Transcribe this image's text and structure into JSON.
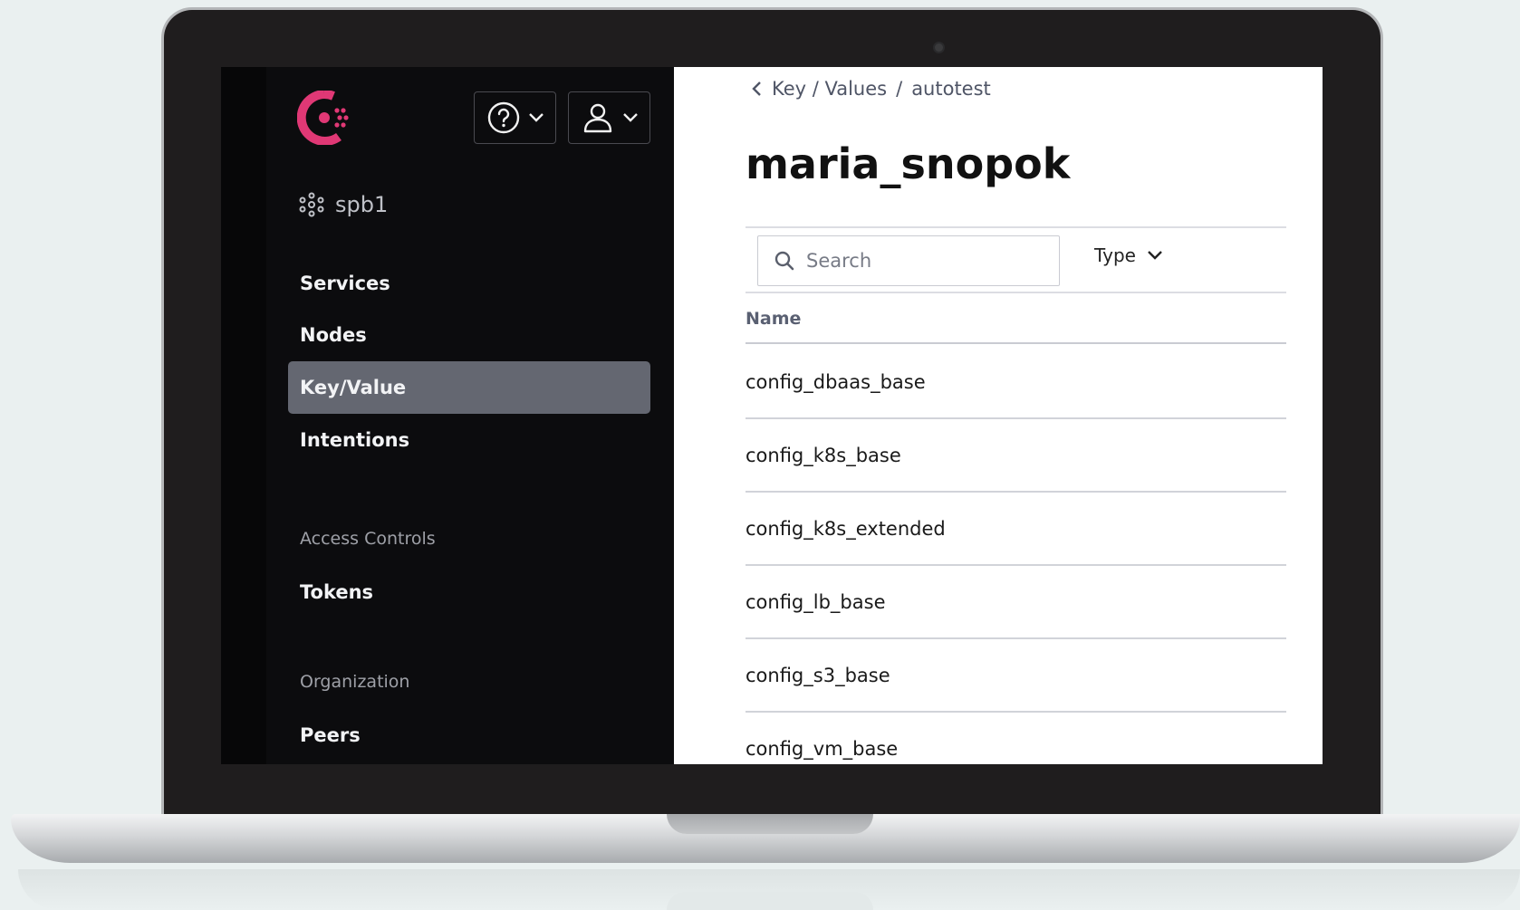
{
  "sidebar": {
    "datacenter": "spb1",
    "nav": [
      {
        "label": "Services"
      },
      {
        "label": "Nodes"
      },
      {
        "label": "Key/Value",
        "active": true
      },
      {
        "label": "Intentions"
      }
    ],
    "access_controls": {
      "heading": "Access Controls",
      "items": [
        {
          "label": "Tokens"
        }
      ]
    },
    "organization": {
      "heading": "Organization",
      "items": [
        {
          "label": "Peers"
        }
      ]
    }
  },
  "header": {
    "help_icon": "help-circle-icon",
    "user_icon": "user-icon"
  },
  "main": {
    "breadcrumb": {
      "parent": "Key / Values",
      "separator": "/",
      "current": "autotest"
    },
    "title": "maria_snopok",
    "search": {
      "placeholder": "Search"
    },
    "type_filter": "Type",
    "column_name": "Name",
    "rows": [
      "config_dbaas_base",
      "config_k8s_base",
      "config_k8s_extended",
      "config_lb_base",
      "config_s3_base",
      "config_vm_base"
    ]
  },
  "colors": {
    "brand": "#e03875",
    "active_nav": "#646771",
    "sidebar": "#0c0c0e"
  }
}
